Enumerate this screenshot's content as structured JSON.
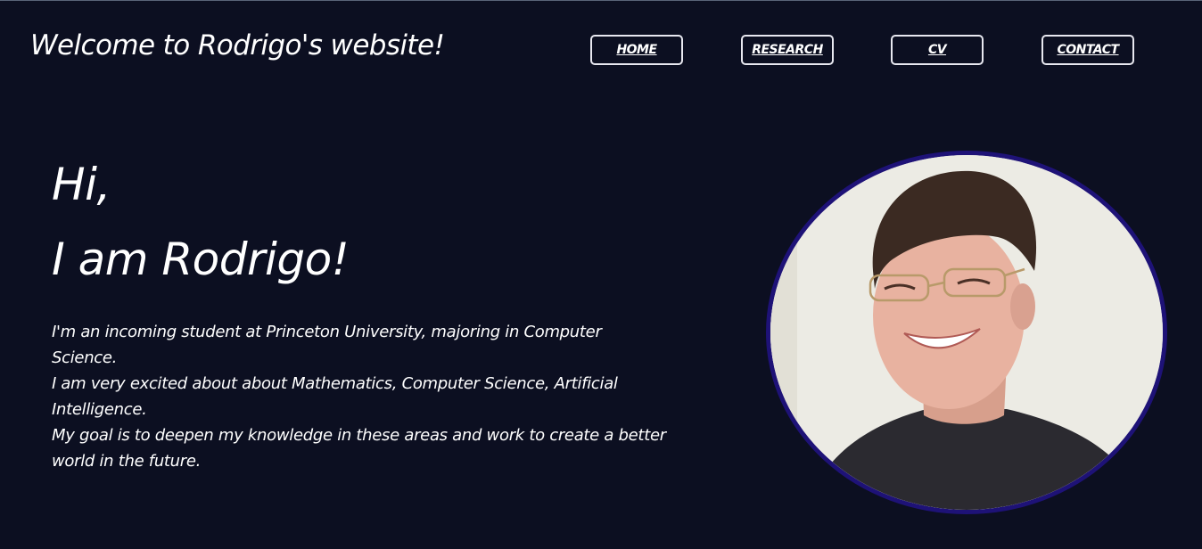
{
  "header": {
    "site_title": "Welcome to Rodrigo's website!",
    "nav": [
      {
        "label": "HOME"
      },
      {
        "label": "RESEARCH"
      },
      {
        "label": "CV"
      },
      {
        "label": "CONTACT"
      }
    ]
  },
  "hero": {
    "greeting_line1": "Hi,",
    "greeting_line2": "I am Rodrigo!",
    "bio": [
      "I'm an incoming student at Princeton University, majoring in Computer Science.",
      "I am very excited about about Mathematics, Computer Science, Artificial Intelligence.",
      "My goal is to deepen my knowledge in these areas and work to create a better world in the future."
    ]
  },
  "portrait": {
    "icon": "portrait-photo"
  },
  "colors": {
    "background": "#0c0f21",
    "text": "#ffffff",
    "portrait_border": "#1e1277"
  }
}
